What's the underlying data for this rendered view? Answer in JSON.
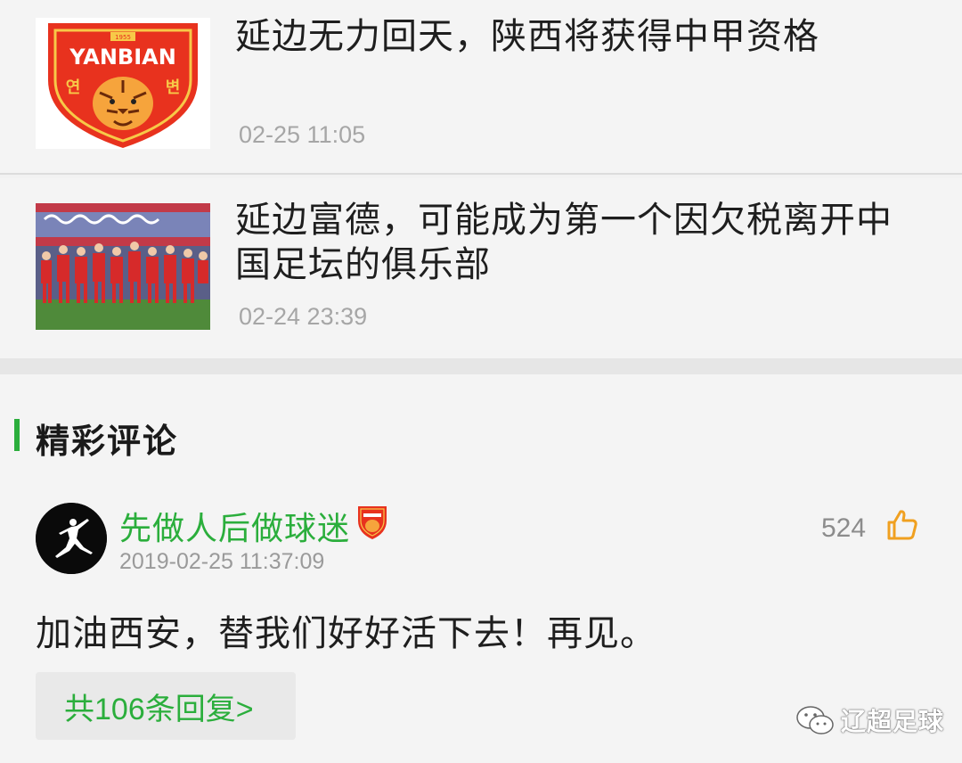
{
  "articles": [
    {
      "title": "延边无力回天，陕西将获得中甲资格",
      "time": "02-25 11:05",
      "thumbnail": {
        "logo_text": "YANBIAN",
        "year_text": "1955",
        "korean_left": "연",
        "korean_right": "변"
      }
    },
    {
      "title": "延边富德，可能成为第一个因欠税离开中国足坛的俱乐部",
      "time": "02-24 23:39"
    }
  ],
  "comments_section": {
    "title": "精彩评论",
    "comment": {
      "username": "先做人后做球迷",
      "timestamp": "2019-02-25 11:37:09",
      "likes": "524",
      "text": "加油西安，替我们好好活下去！再见。",
      "reply_label": "共106条回复>"
    }
  },
  "watermark": {
    "text": "辽超足球"
  },
  "colors": {
    "accent_green": "#2bae3c",
    "badge_red": "#e8321e",
    "like_orange": "#f0a020"
  }
}
